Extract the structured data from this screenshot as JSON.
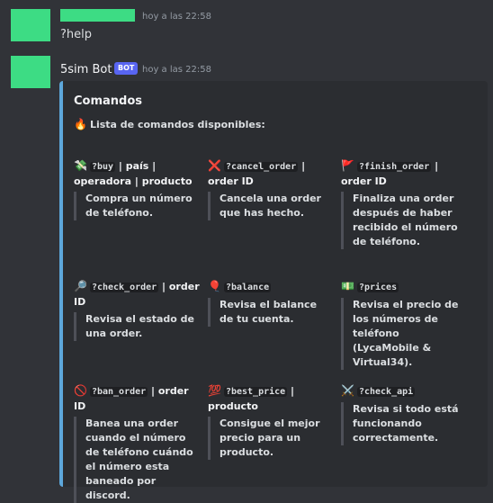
{
  "message1": {
    "timestamp": "hoy a las 22:58",
    "content": "?help"
  },
  "message2": {
    "author": "5sim Bot",
    "badge": "BOT",
    "timestamp": "hoy a las 22:58",
    "embed": {
      "title": "Comandos",
      "description": "Lista de comandos disponibles:",
      "fields": [
        {
          "emoji": "💸",
          "command": "?buy",
          "rest": " | país | operadora | producto",
          "value": "Compra un número de teléfono."
        },
        {
          "emoji": "❌",
          "command": "?cancel_order",
          "rest": " | order ID",
          "value": "Cancela una order que has hecho."
        },
        {
          "emoji": "🚩",
          "command": "?finish_order",
          "rest": " | order ID",
          "value": "Finaliza una order después de haber recibido el número de teléfono."
        },
        {
          "emoji": "🔎",
          "command": "?check_order",
          "rest": " | order ID",
          "value": "Revisa el estado de una order."
        },
        {
          "emoji": "🎈",
          "command": "?balance",
          "rest": "",
          "value": "Revisa el balance de tu cuenta."
        },
        {
          "emoji": "💵",
          "command": "?prices",
          "rest": "",
          "value": "Revisa el precio de los números de teléfono (LycaMobile & Virtual34)."
        },
        {
          "emoji": "🚫",
          "command": "?ban_order",
          "rest": " | order ID",
          "value": "Banea una order cuando el número de teléfono cuándo el número esta baneado por discord."
        },
        {
          "emoji": "💯",
          "command": "?best_price",
          "rest": " | producto",
          "value": "Consigue el mejor precio para un producto."
        },
        {
          "emoji": "⚔️",
          "command": "?check_api",
          "rest": "",
          "value": "Revisa si todo está funcionando correctamente."
        }
      ]
    }
  },
  "icons": {
    "fire": "🔥"
  }
}
